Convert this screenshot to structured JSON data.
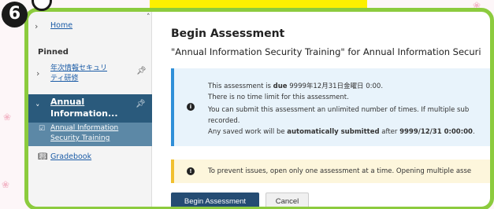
{
  "overlay": {
    "step_number": "6"
  },
  "sidebar": {
    "home_label": "Home",
    "pinned_heading": "Pinned",
    "item_jp_line1": "年次情報セキュリ",
    "item_jp_line2": "ティ研修",
    "active_line1": "Annual",
    "active_line2": "Information...",
    "sub_line1": "Annual Information",
    "sub_line2": "Security Training",
    "gradebook_label": "Gradebook"
  },
  "main": {
    "title": "Begin Assessment",
    "subtitle": "\"Annual Information Security Training\" for Annual Information Securi",
    "info": {
      "line1_pre": "This assessment is ",
      "line1_bold": "due",
      "line1_post": " 9999年12月31日金曜日 0:00.",
      "line2": "There is no time limit for this assessment.",
      "line3": "You can submit this assessment an unlimited number of times. If multiple sub",
      "line4": "recorded.",
      "line5_pre": "Any saved work will be ",
      "line5_bold": "automatically submitted",
      "line5_mid": " after ",
      "line5_date": "9999/12/31 0:00:00",
      "line5_end": "."
    },
    "warning": "To prevent issues, open only one assessment at a time. Opening multiple asse",
    "begin_button": "Begin Assessment",
    "cancel_button": "Cancel"
  },
  "colors": {
    "frame": "#8ccb3e",
    "active": "#2a5a7c",
    "primary": "#254c73",
    "info_accent": "#2f8fd8",
    "warn_accent": "#f1c02f"
  }
}
